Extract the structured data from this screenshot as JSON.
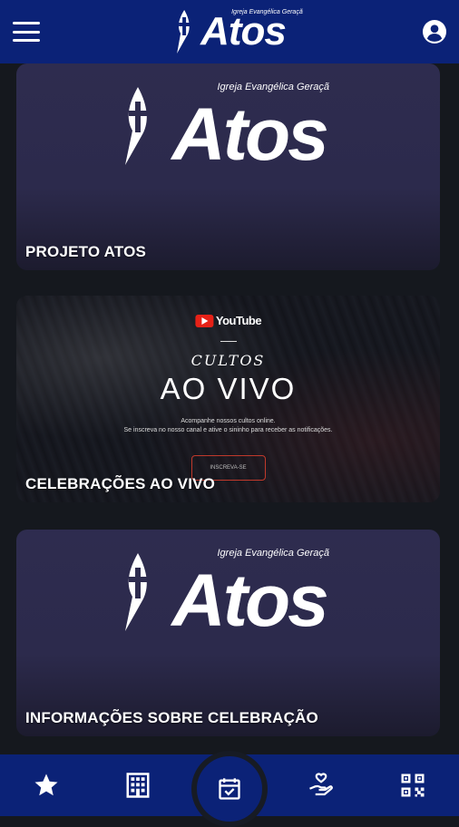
{
  "header": {
    "brand_tagline": "Igreja Evangélica Geraçã",
    "brand_name": "Atos"
  },
  "cards": [
    {
      "title": "PROJETO ATOS",
      "logo_tagline": "Igreja Evangélica Geraçã",
      "logo_name": "Atos"
    },
    {
      "title": "CELEBRAÇÕES AO VIVO",
      "video": {
        "platform": "YouTube",
        "heading_small": "CULTOS",
        "heading_large": "AO VIVO",
        "line1": "Acompanhe nossos cultos online.",
        "line2": "Se inscreva no nosso canal e ative o sininho para receber as notificações.",
        "button": "INSCREVA-SE"
      }
    },
    {
      "title": "INFORMAÇÕES SOBRE CELEBRAÇÃO",
      "logo_tagline": "Igreja Evangélica Geraçã",
      "logo_name": "Atos"
    }
  ],
  "colors": {
    "primary": "#0b2277",
    "card_bg": "#2c2a4c",
    "page_bg": "#15181e"
  },
  "bottom_nav": {
    "items": [
      "star-icon",
      "building-icon",
      "calendar-check-icon",
      "donate-hand-icon",
      "qr-code-icon"
    ]
  }
}
